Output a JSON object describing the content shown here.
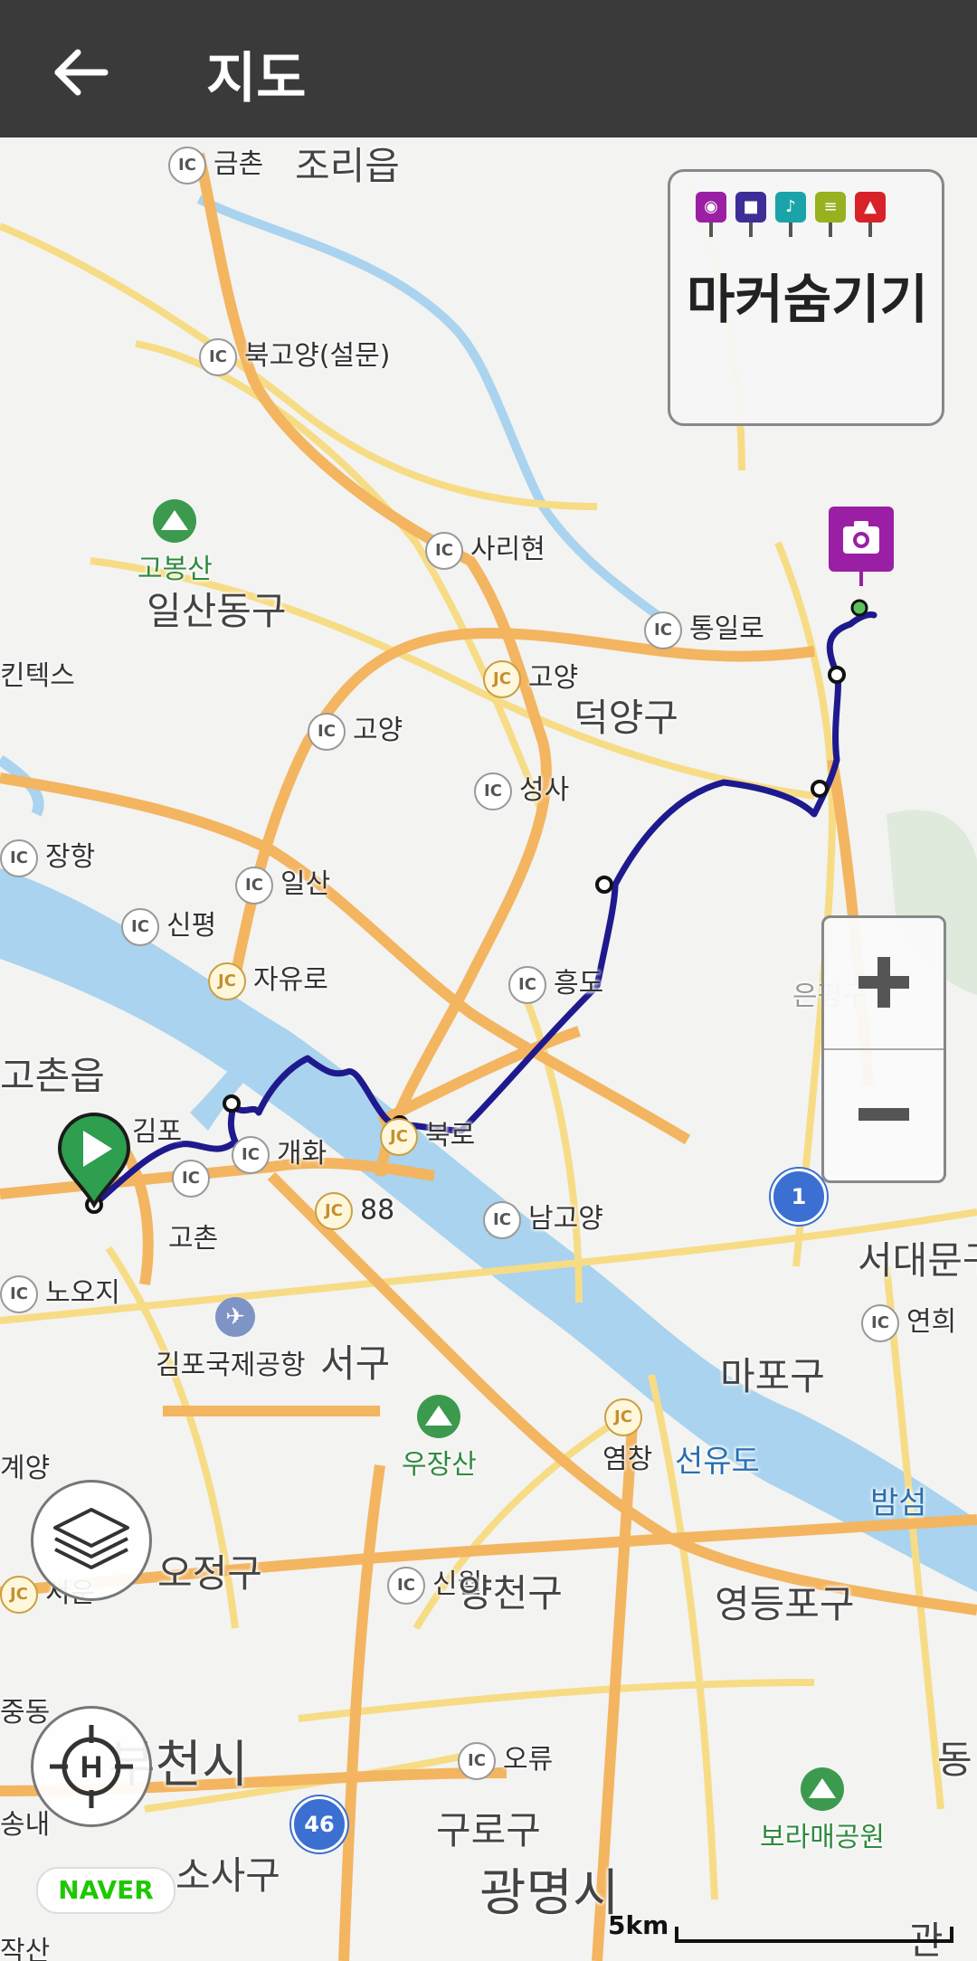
{
  "appbar": {
    "title": "지도",
    "back_icon": "arrow-left-icon"
  },
  "legend": {
    "label": "마커숨기기",
    "icons": [
      {
        "name": "photo-marker-icon",
        "color": "#9b1fa4",
        "glyph": "📷"
      },
      {
        "name": "video-marker-icon",
        "color": "#3d2d96",
        "glyph": "■"
      },
      {
        "name": "audio-marker-icon",
        "color": "#1aa3a8",
        "glyph": "♪"
      },
      {
        "name": "memo-marker-icon",
        "color": "#97b11f",
        "glyph": "≡"
      },
      {
        "name": "flag-marker-icon",
        "color": "#d8222a",
        "glyph": "▲"
      }
    ]
  },
  "map": {
    "labels": {
      "geumchon": "금촌",
      "jorieup": "조리읍",
      "bukgoyang": "북고양(설문)",
      "gobongsan": "고봉산",
      "ilsandonggu": "일산동구",
      "kintex": "킨텍스",
      "sarihyeon": "사리현",
      "tongilro": "통일로",
      "goyang_jc": "고양",
      "goyang_ic": "고양",
      "deogyanggu": "덕양구",
      "seongsa": "성사",
      "janghang": "장항",
      "ilsan": "일산",
      "sinpyeong": "신평",
      "jayuro": "자유로",
      "heungdo": "흥도",
      "gochoneup": "고촌읍",
      "gimpo": "김포",
      "gaehwa": "개화",
      "bukro": "북로",
      "gochon": "고촌",
      "jc88": "88",
      "namgoyang": "남고양",
      "nooji": "노오지",
      "gimpoairport": "김포국제공항",
      "seogu": "서구",
      "seodaemun": "서대문구",
      "yeonhui": "연희",
      "mapogu": "마포구",
      "ujangsan": "우장산",
      "yeomchang": "염창",
      "seonyudo": "선유도",
      "bamseom": "밤섬",
      "gyeyang": "계양",
      "ojeonggu": "오정구",
      "sinwol": "신월",
      "yangcheongu": "양천구",
      "yeongdeungpogu": "영등포구",
      "seoun": "서운",
      "jungdong": "중동",
      "bucheonsi": "부천시",
      "oryu": "오류",
      "dong": "동",
      "songnae": "송내",
      "guro": "구로구",
      "sosagu": "소사구",
      "gwangmyeongsi": "광명시",
      "boramae": "보라매공원",
      "eunpyeong": "은평구",
      "jaksa": "작산",
      "gwanak": "관"
    },
    "shields": {
      "route1": "1",
      "route46": "46"
    },
    "route_color": "#1e1a8e",
    "attribution": "NAVER",
    "scale_label": "5km"
  },
  "controls": {
    "zoom_in_icon": "plus-icon",
    "zoom_out_icon": "minus-icon",
    "layers_icon": "layers-icon",
    "locate_icon": "locate-home-icon"
  }
}
